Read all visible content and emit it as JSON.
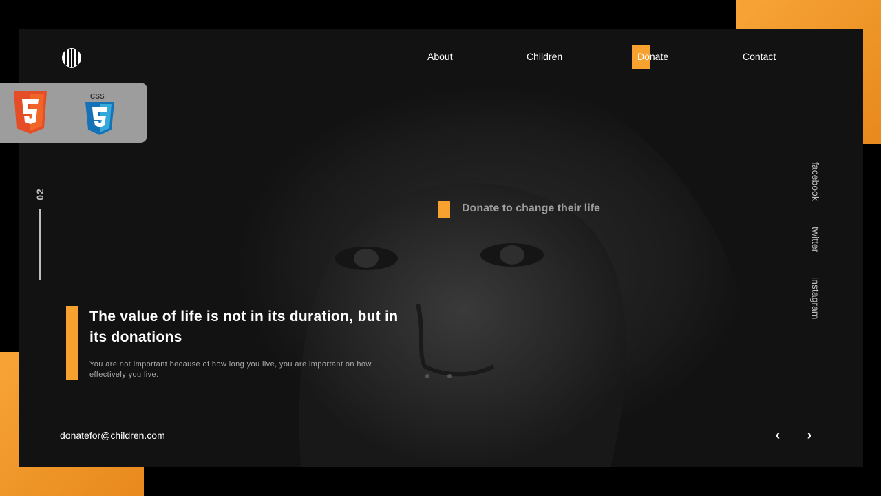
{
  "nav": {
    "items": [
      "About",
      "Children",
      "Donate",
      "Contact"
    ],
    "active": "Donate"
  },
  "badges": {
    "html_label": "HTML5",
    "css_label": "CSS"
  },
  "slide": {
    "number": "02"
  },
  "tagline": "Donate to change their life",
  "social": [
    "facebook",
    "twitter",
    "instagram"
  ],
  "hero": {
    "headline": "The value of life is not in its duration, but in its donations",
    "subtext": "You are not important because of how long you live, you are important on how effectively you live."
  },
  "footer": {
    "email": "donatefor@children.com",
    "prev_icon": "chevron-left-icon",
    "next_icon": "chevron-right-icon"
  },
  "colors": {
    "accent": "#f7a12e",
    "background": "#121212",
    "text": "#ffffff",
    "muted": "#a9a9a9"
  }
}
